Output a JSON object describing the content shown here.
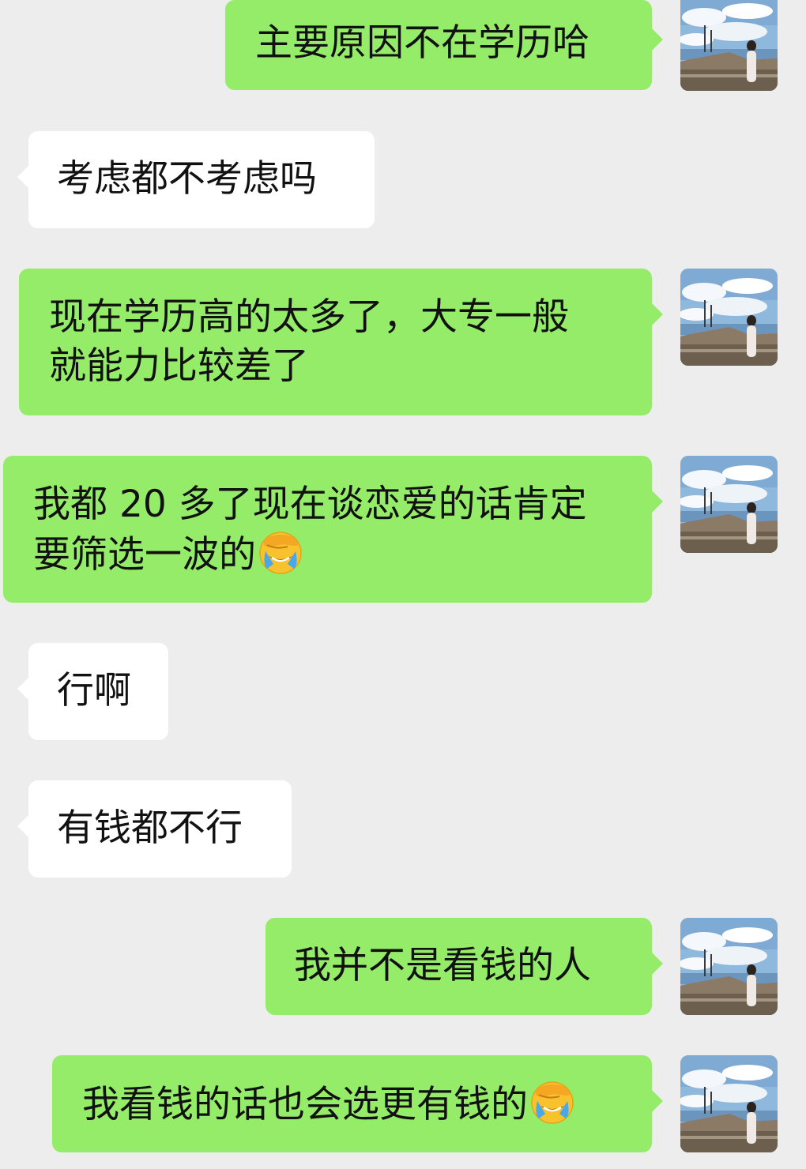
{
  "chat": {
    "messages": [
      {
        "sender": "me",
        "text": "主要原因不在学历哈"
      },
      {
        "sender": "other",
        "text": "考虑都不考虑吗"
      },
      {
        "sender": "me",
        "line1": "现在学历高的太多了，大专一般",
        "line2": "就能力比较差了"
      },
      {
        "sender": "me",
        "line1": "我都 20 多了现在谈恋爱的话肯定",
        "line2": "要筛选一波的",
        "emoji": "face-palm-laughing-emoji"
      },
      {
        "sender": "other",
        "text": "行啊"
      },
      {
        "sender": "other",
        "text": "有钱都不行"
      },
      {
        "sender": "me",
        "text": "我并不是看钱的人"
      },
      {
        "sender": "me",
        "text": "我看钱的话也会选更有钱的",
        "emoji": "face-palm-laughing-emoji"
      }
    ]
  },
  "colors": {
    "background": "#ededed",
    "my_bubble": "#95ec69",
    "their_bubble": "#ffffff",
    "text": "#111111"
  }
}
